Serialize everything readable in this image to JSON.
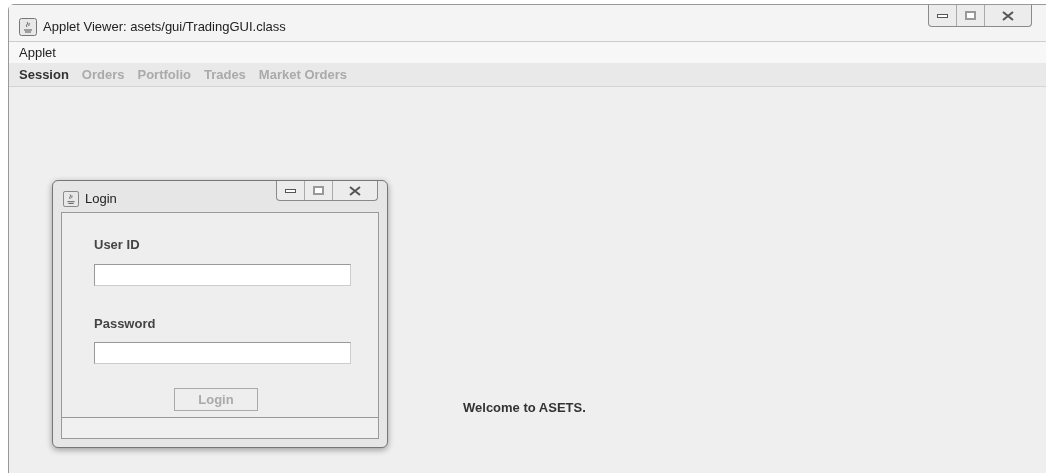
{
  "window": {
    "title": "Applet Viewer: asets/gui/TradingGUI.class"
  },
  "menu": [
    "Applet"
  ],
  "tabs": [
    {
      "label": "Session",
      "selected": true
    },
    {
      "label": "Orders",
      "selected": false
    },
    {
      "label": "Portfolio",
      "selected": false
    },
    {
      "label": "Trades",
      "selected": false
    },
    {
      "label": "Market Orders",
      "selected": false
    }
  ],
  "login_dialog": {
    "title": "Login",
    "fields": [
      {
        "label": "User ID"
      },
      {
        "label": "Password"
      }
    ],
    "button": {
      "label": "Login",
      "disabled": true
    }
  },
  "welcome": "Welcome to ASETS."
}
